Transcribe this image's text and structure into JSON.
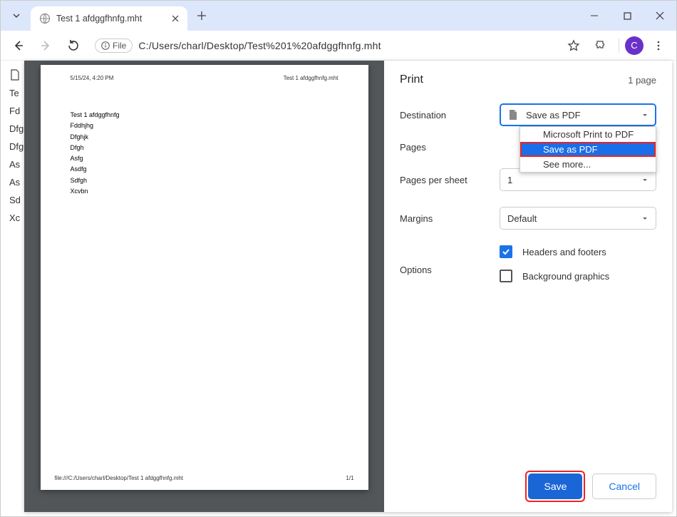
{
  "window": {
    "tab_title": "Test 1 afdggfhnfg.mht"
  },
  "toolbar": {
    "file_badge": "File",
    "url": "C:/Users/charl/Desktop/Test%201%20afdggfhnfg.mht",
    "avatar_letter": "C"
  },
  "sidebar_bleed": [
    "Te",
    "Fd",
    "Dfg",
    "Dfg",
    "As",
    "As",
    "Sd",
    "Xc"
  ],
  "preview": {
    "datetime": "5/15/24, 4:20 PM",
    "title": "Test 1 afdggfhnfg.mht",
    "lines": [
      "Test 1 afdggfhnfg",
      "Fddhjhg",
      "Dfghjk",
      "Dfgh",
      "Asfg",
      "Asdfg",
      "Sdfgh",
      "Xcvbn"
    ],
    "footer_path": "file:///C:/Users/charl/Desktop/Test 1 afdggfhnfg.mht",
    "page_indicator": "1/1"
  },
  "print": {
    "title": "Print",
    "page_count": "1 page",
    "labels": {
      "destination": "Destination",
      "pages": "Pages",
      "pps": "Pages per sheet",
      "margins": "Margins",
      "options": "Options"
    },
    "destination": {
      "selected": "Save as PDF",
      "options": [
        "Microsoft Print to PDF",
        "Save as PDF",
        "See more..."
      ]
    },
    "pps_value": "1",
    "margins_value": "Default",
    "opt_headers": "Headers and footers",
    "opt_bg": "Background graphics",
    "btn_save": "Save",
    "btn_cancel": "Cancel"
  }
}
